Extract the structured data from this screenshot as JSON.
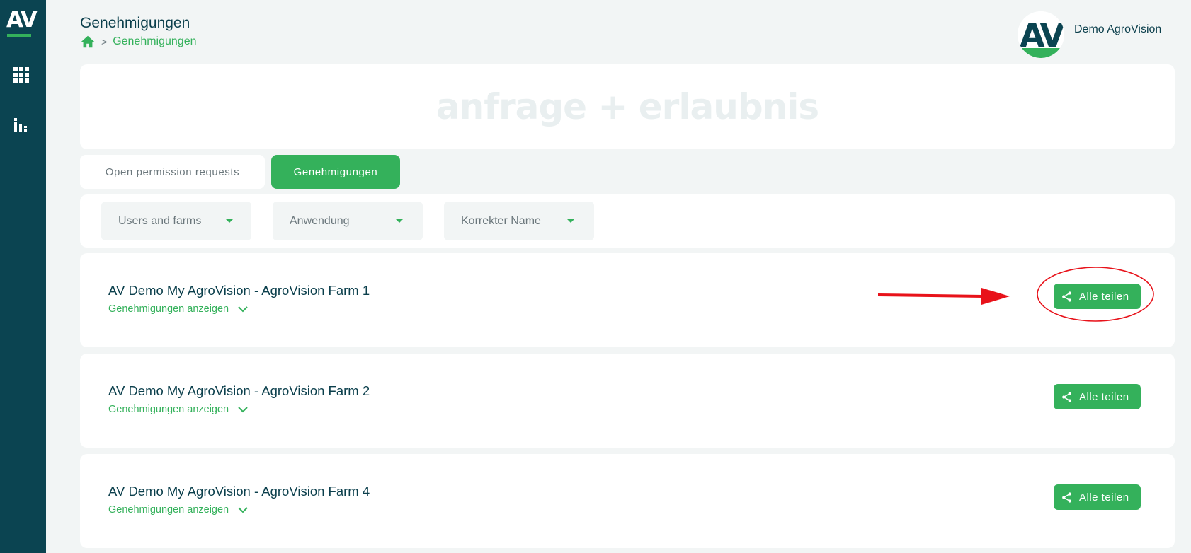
{
  "app": {
    "logo_text": "AV"
  },
  "sidebar": {
    "items": [
      {
        "icon": "grid-icon"
      },
      {
        "icon": "bar-chart-icon"
      }
    ]
  },
  "header": {
    "title": "Genehmigungen",
    "breadcrumb": {
      "home_icon": "home-icon",
      "separator": ">",
      "current": "Genehmigungen"
    }
  },
  "user": {
    "name": "Demo AgroVision",
    "avatar_text": "AV"
  },
  "hero": {
    "text": "anfrage + erlaubnis"
  },
  "tabs": [
    {
      "label": "Open permission requests",
      "active": false
    },
    {
      "label": "Genehmigungen",
      "active": true
    }
  ],
  "filters": [
    {
      "label": "Users and farms"
    },
    {
      "label": "Anwendung"
    },
    {
      "label": "Korrekter Name"
    }
  ],
  "farms": [
    {
      "title": "AV Demo My AgroVision - AgroVision Farm 1",
      "toggle_label": "Genehmigungen anzeigen",
      "share_label": "Alle teilen"
    },
    {
      "title": "AV Demo My AgroVision - AgroVision Farm 2",
      "toggle_label": "Genehmigungen anzeigen",
      "share_label": "Alle teilen"
    },
    {
      "title": "AV Demo My AgroVision - AgroVision Farm 4",
      "toggle_label": "Genehmigungen anzeigen",
      "share_label": "Alle teilen"
    }
  ],
  "colors": {
    "sidebar": "#0b4451",
    "accent": "#34b15b",
    "text_dark": "#0b3f4c",
    "background": "#f2f5f5",
    "annotation": "#e8121a"
  }
}
